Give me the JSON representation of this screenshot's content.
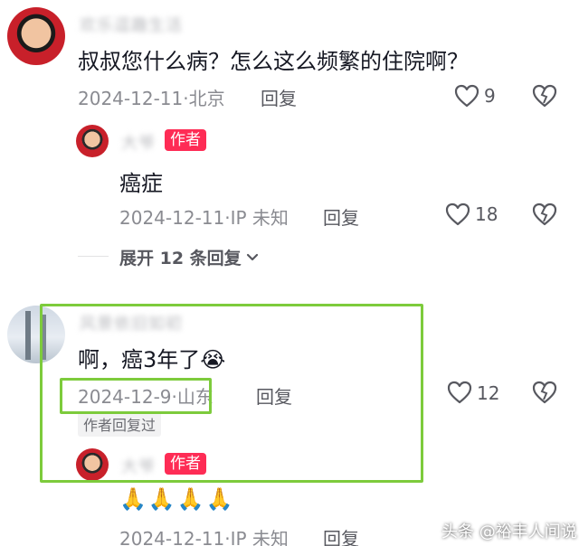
{
  "comments": [
    {
      "username": "欢乐逗趣生活",
      "text": "叔叔您什么病？怎么这么频繁的住院啊？",
      "date": "2024-12-11",
      "location": "北京",
      "reply_label": "回复",
      "likes": "9",
      "replies": [
        {
          "username": "大爷",
          "badge": "作者",
          "text": "癌症",
          "date": "2024-12-11",
          "location": "IP 未知",
          "reply_label": "回复",
          "likes": "18"
        }
      ],
      "expand_label": "展开 12 条回复"
    },
    {
      "username": "风景依旧如初",
      "text": "啊，癌3年了😭",
      "date": "2024-12-9",
      "location": "山东",
      "reply_label": "回复",
      "likes": "12",
      "author_replied_tag": "作者回复过",
      "replies": [
        {
          "username": "大爷",
          "badge": "作者",
          "text": "🙏🙏🙏🙏",
          "date": "2024-12-11",
          "location": "IP 未知",
          "reply_label": "回复"
        }
      ]
    }
  ],
  "watermark": "头条 @裕丰人间说",
  "colors": {
    "badge": "#fe2c55",
    "highlight_box": "#7dcb3c",
    "meta_text": "#8a8b91"
  }
}
